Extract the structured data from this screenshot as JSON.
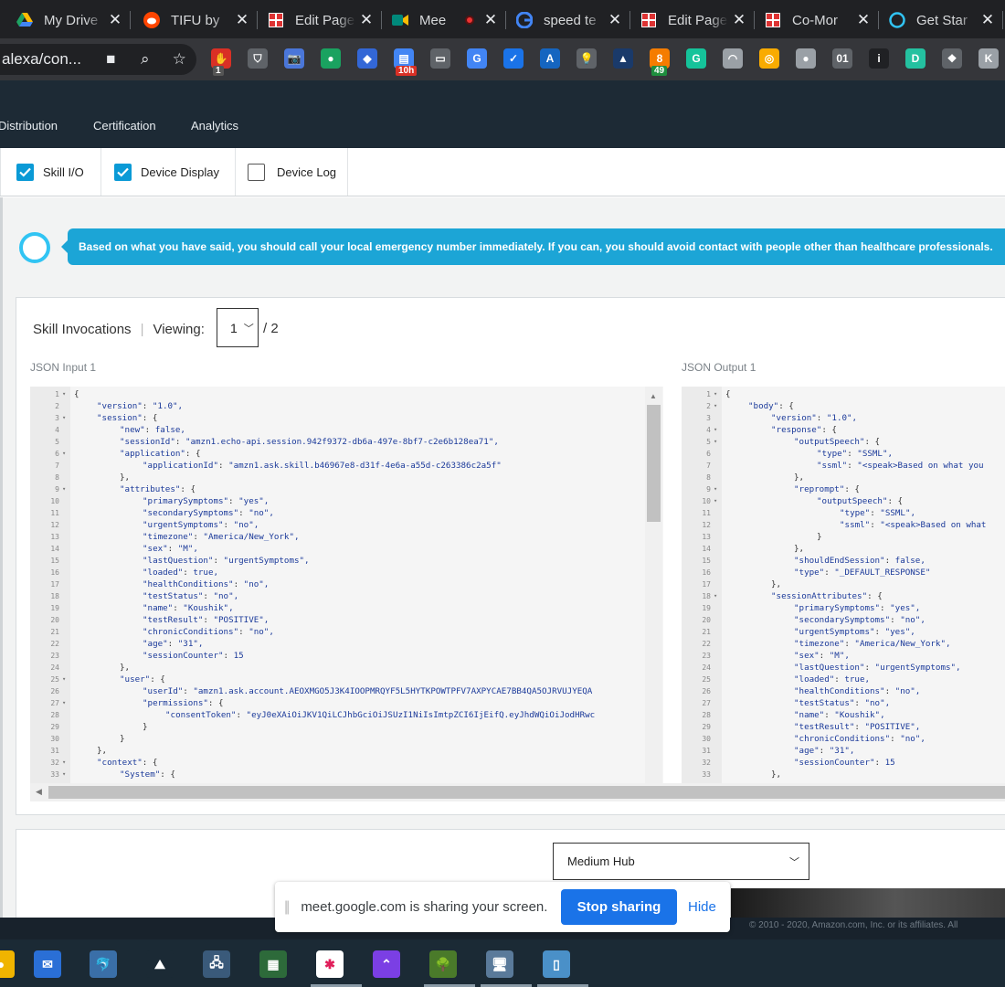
{
  "browser": {
    "tabs": [
      {
        "title": "My Drive",
        "icon": "google-drive-icon",
        "color": "#fbbc04"
      },
      {
        "title": "TIFU by",
        "icon": "reddit-icon",
        "color": "#ff4500"
      },
      {
        "title": "Edit Page",
        "icon": "page-icon",
        "color": "#d33"
      },
      {
        "title": "Mee",
        "icon": "google-meet-icon",
        "color": "#00897b"
      },
      {
        "title": "speed te",
        "icon": "google-icon",
        "color": "#4285f4"
      },
      {
        "title": "Edit Page",
        "icon": "page-icon",
        "color": "#d33"
      },
      {
        "title": "Co-Mor",
        "icon": "page-icon",
        "color": "#d33"
      },
      {
        "title": "Get Star",
        "icon": "alexa-icon",
        "color": "#31c4f3"
      }
    ],
    "url": "alexa/con...",
    "extensions": [
      {
        "name": "hand-stop-extension-icon",
        "color": "#d93025",
        "label": "✋",
        "badge": "1",
        "badge_color": "#555"
      },
      {
        "name": "pocket-extension-icon",
        "color": "#5f6368",
        "label": "⛉"
      },
      {
        "name": "camera-extension-icon",
        "color": "#4a76d9",
        "label": "📷"
      },
      {
        "name": "chat-bubble-extension-icon",
        "color": "#1aa260",
        "label": "●"
      },
      {
        "name": "arrow-extension-icon",
        "color": "#3367d6",
        "label": "◆"
      },
      {
        "name": "calendar-extension-icon",
        "color": "#4285f4",
        "label": "▤",
        "badge": "10h",
        "badge_color": "#d93025"
      },
      {
        "name": "cast-extension-icon",
        "color": "#5f6368",
        "label": "▭"
      },
      {
        "name": "translate-extension-icon",
        "color": "#4285f4",
        "label": "G"
      },
      {
        "name": "todo-extension-icon",
        "color": "#1a73e8",
        "label": "✓"
      },
      {
        "name": "font-extension-icon",
        "color": "#1565c0",
        "label": "A"
      },
      {
        "name": "bulb-extension-icon",
        "color": "#5f6368",
        "label": "💡"
      },
      {
        "name": "grid-extension-icon",
        "color": "#1a3a6a",
        "label": "▲"
      },
      {
        "name": "notes-extension-icon",
        "color": "#f57c00",
        "label": "8",
        "badge": "49",
        "badge_color": "#1e8e3e"
      },
      {
        "name": "grammarly-icon",
        "color": "#15c39a",
        "label": "G"
      },
      {
        "name": "arch-extension-icon",
        "color": "#9aa0a6",
        "label": "◠"
      },
      {
        "name": "compass-extension-icon",
        "color": "#f9ab00",
        "label": "◎"
      },
      {
        "name": "circle-extension-icon",
        "color": "#9aa0a6",
        "label": "●"
      },
      {
        "name": "binary-extension-icon",
        "color": "#5f6368",
        "label": "01"
      },
      {
        "name": "info-extension-icon",
        "color": "#202124",
        "label": "i"
      },
      {
        "name": "d-extension-icon",
        "color": "#24c1a0",
        "label": "D"
      },
      {
        "name": "dropbox-icon",
        "color": "#5f6368",
        "label": "❖"
      },
      {
        "name": "k-extension-icon",
        "color": "#9aa0a6",
        "label": "K"
      }
    ]
  },
  "console_nav": {
    "items": [
      "Distribution",
      "Certification",
      "Analytics"
    ]
  },
  "options": [
    {
      "label": "Skill I/O",
      "checked": true
    },
    {
      "label": "Device Display",
      "checked": true
    },
    {
      "label": "Device Log",
      "checked": false
    }
  ],
  "alexa_response": "Based on what you have said, you should call your local emergency number immediately. If you can, you should avoid contact with people other than healthcare professionals.",
  "invocations": {
    "title": "Skill Invocations",
    "viewing_label": "Viewing:",
    "selected": "1",
    "total": "/ 2"
  },
  "json_input": {
    "title": "JSON Input 1",
    "lines": [
      {
        "n": "1",
        "fold": true,
        "indent": 0,
        "text": "{"
      },
      {
        "n": "2",
        "indent": 1,
        "key": "\"version\"",
        "val": "\"1.0\","
      },
      {
        "n": "3",
        "fold": true,
        "indent": 1,
        "key": "\"session\"",
        "val": "{"
      },
      {
        "n": "4",
        "indent": 2,
        "key": "\"new\"",
        "val": "false,"
      },
      {
        "n": "5",
        "indent": 2,
        "key": "\"sessionId\"",
        "val": "\"amzn1.echo-api.session.942f9372-db6a-497e-8bf7-c2e6b128ea71\","
      },
      {
        "n": "6",
        "fold": true,
        "indent": 2,
        "key": "\"application\"",
        "val": "{"
      },
      {
        "n": "7",
        "indent": 3,
        "key": "\"applicationId\"",
        "val": "\"amzn1.ask.skill.b46967e8-d31f-4e6a-a55d-c263386c2a5f\""
      },
      {
        "n": "8",
        "indent": 2,
        "text": "},"
      },
      {
        "n": "9",
        "fold": true,
        "indent": 2,
        "key": "\"attributes\"",
        "val": "{"
      },
      {
        "n": "10",
        "indent": 3,
        "key": "\"primarySymptoms\"",
        "val": "\"yes\","
      },
      {
        "n": "11",
        "indent": 3,
        "key": "\"secondarySymptoms\"",
        "val": "\"no\","
      },
      {
        "n": "12",
        "indent": 3,
        "key": "\"urgentSymptoms\"",
        "val": "\"no\","
      },
      {
        "n": "13",
        "indent": 3,
        "key": "\"timezone\"",
        "val": "\"America/New_York\","
      },
      {
        "n": "14",
        "indent": 3,
        "key": "\"sex\"",
        "val": "\"M\","
      },
      {
        "n": "15",
        "indent": 3,
        "key": "\"lastQuestion\"",
        "val": "\"urgentSymptoms\","
      },
      {
        "n": "16",
        "indent": 3,
        "key": "\"loaded\"",
        "val": "true,"
      },
      {
        "n": "17",
        "indent": 3,
        "key": "\"healthConditions\"",
        "val": "\"no\","
      },
      {
        "n": "18",
        "indent": 3,
        "key": "\"testStatus\"",
        "val": "\"no\","
      },
      {
        "n": "19",
        "indent": 3,
        "key": "\"name\"",
        "val": "\"Koushik\","
      },
      {
        "n": "20",
        "indent": 3,
        "key": "\"testResult\"",
        "val": "\"POSITIVE\","
      },
      {
        "n": "21",
        "indent": 3,
        "key": "\"chronicConditions\"",
        "val": "\"no\","
      },
      {
        "n": "22",
        "indent": 3,
        "key": "\"age\"",
        "val": "\"31\","
      },
      {
        "n": "23",
        "indent": 3,
        "key": "\"sessionCounter\"",
        "val": "15"
      },
      {
        "n": "24",
        "indent": 2,
        "text": "},"
      },
      {
        "n": "25",
        "fold": true,
        "indent": 2,
        "key": "\"user\"",
        "val": "{"
      },
      {
        "n": "26",
        "indent": 3,
        "key": "\"userId\"",
        "val": "\"amzn1.ask.account.AEOXMGO5J3K4IOOPMRQYF5L5HYTKPOWTPFV7AXPYCAE7BB4QA5OJRVUJYEQA"
      },
      {
        "n": "27",
        "fold": true,
        "indent": 3,
        "key": "\"permissions\"",
        "val": "{"
      },
      {
        "n": "28",
        "indent": 4,
        "key": "\"consentToken\"",
        "val": "\"eyJ0eXAiOiJKV1QiLCJhbGciOiJSUzI1NiIsImtpZCI6IjEifQ.eyJhdWQiOiJodHRwc"
      },
      {
        "n": "29",
        "indent": 3,
        "text": "}"
      },
      {
        "n": "30",
        "indent": 2,
        "text": "}"
      },
      {
        "n": "31",
        "indent": 1,
        "text": "},"
      },
      {
        "n": "32",
        "fold": true,
        "indent": 1,
        "key": "\"context\"",
        "val": "{"
      },
      {
        "n": "33",
        "fold": true,
        "indent": 2,
        "key": "\"System\"",
        "val": "{"
      }
    ]
  },
  "json_output": {
    "title": "JSON Output 1",
    "lines": [
      {
        "n": "1",
        "fold": true,
        "indent": 0,
        "text": "{"
      },
      {
        "n": "2",
        "fold": true,
        "indent": 1,
        "key": "\"body\"",
        "val": "{"
      },
      {
        "n": "3",
        "indent": 2,
        "key": "\"version\"",
        "val": "\"1.0\","
      },
      {
        "n": "4",
        "fold": true,
        "indent": 2,
        "key": "\"response\"",
        "val": "{"
      },
      {
        "n": "5",
        "fold": true,
        "indent": 3,
        "key": "\"outputSpeech\"",
        "val": "{"
      },
      {
        "n": "6",
        "indent": 4,
        "key": "\"type\"",
        "val": "\"SSML\","
      },
      {
        "n": "7",
        "indent": 4,
        "key": "\"ssml\"",
        "val": "\"<speak>Based on what you"
      },
      {
        "n": "8",
        "indent": 3,
        "text": "},"
      },
      {
        "n": "9",
        "fold": true,
        "indent": 3,
        "key": "\"reprompt\"",
        "val": "{"
      },
      {
        "n": "10",
        "fold": true,
        "indent": 4,
        "key": "\"outputSpeech\"",
        "val": "{"
      },
      {
        "n": "11",
        "indent": 5,
        "key": "\"type\"",
        "val": "\"SSML\","
      },
      {
        "n": "12",
        "indent": 5,
        "key": "\"ssml\"",
        "val": "\"<speak>Based on what"
      },
      {
        "n": "13",
        "indent": 4,
        "text": "}"
      },
      {
        "n": "14",
        "indent": 3,
        "text": "},"
      },
      {
        "n": "15",
        "indent": 3,
        "key": "\"shouldEndSession\"",
        "val": "false,"
      },
      {
        "n": "16",
        "indent": 3,
        "key": "\"type\"",
        "val": "\"_DEFAULT_RESPONSE\""
      },
      {
        "n": "17",
        "indent": 2,
        "text": "},"
      },
      {
        "n": "18",
        "fold": true,
        "indent": 2,
        "key": "\"sessionAttributes\"",
        "val": "{"
      },
      {
        "n": "19",
        "indent": 3,
        "key": "\"primarySymptoms\"",
        "val": "\"yes\","
      },
      {
        "n": "20",
        "indent": 3,
        "key": "\"secondarySymptoms\"",
        "val": "\"no\","
      },
      {
        "n": "21",
        "indent": 3,
        "key": "\"urgentSymptoms\"",
        "val": "\"yes\","
      },
      {
        "n": "22",
        "indent": 3,
        "key": "\"timezone\"",
        "val": "\"America/New_York\","
      },
      {
        "n": "23",
        "indent": 3,
        "key": "\"sex\"",
        "val": "\"M\","
      },
      {
        "n": "24",
        "indent": 3,
        "key": "\"lastQuestion\"",
        "val": "\"urgentSymptoms\","
      },
      {
        "n": "25",
        "indent": 3,
        "key": "\"loaded\"",
        "val": "true,"
      },
      {
        "n": "26",
        "indent": 3,
        "key": "\"healthConditions\"",
        "val": "\"no\","
      },
      {
        "n": "27",
        "indent": 3,
        "key": "\"testStatus\"",
        "val": "\"no\","
      },
      {
        "n": "28",
        "indent": 3,
        "key": "\"name\"",
        "val": "\"Koushik\","
      },
      {
        "n": "29",
        "indent": 3,
        "key": "\"testResult\"",
        "val": "\"POSITIVE\","
      },
      {
        "n": "30",
        "indent": 3,
        "key": "\"chronicConditions\"",
        "val": "\"no\","
      },
      {
        "n": "31",
        "indent": 3,
        "key": "\"age\"",
        "val": "\"31\","
      },
      {
        "n": "32",
        "indent": 3,
        "key": "\"sessionCounter\"",
        "val": "15"
      },
      {
        "n": "33",
        "indent": 2,
        "text": "},"
      }
    ]
  },
  "device": {
    "selected": "Medium Hub"
  },
  "screen_share": {
    "message": "meet.google.com is sharing your screen.",
    "stop_label": "Stop sharing",
    "hide_label": "Hide"
  },
  "footer": {
    "copyright": "© 2010 - 2020, Amazon.com, Inc. or its affiliates. All"
  },
  "taskbar": [
    {
      "name": "windows-search-icon",
      "color": "#f0b400",
      "label": "●"
    },
    {
      "name": "thunderbird-icon",
      "color": "#2a6fd6",
      "label": "✉"
    },
    {
      "name": "mysql-workbench-icon",
      "color": "#3a6fa8",
      "label": "🐬"
    },
    {
      "name": "mountain-app-icon",
      "color": "#1b2a35",
      "label": "⛰"
    },
    {
      "name": "network-icon",
      "color": "#3a5a7a",
      "label": "🖧"
    },
    {
      "name": "terminal-icon",
      "color": "#2d6a3a",
      "label": "▦"
    },
    {
      "name": "slack-icon",
      "color": "#ffffff",
      "label": "✱"
    },
    {
      "name": "clickup-icon",
      "color": "#7b3fe4",
      "label": "⌃"
    },
    {
      "name": "tree-app-icon",
      "color": "#4a7a2a",
      "label": "🌳"
    },
    {
      "name": "remote-desktop-icon",
      "color": "#5a7a9a",
      "label": "🖥"
    },
    {
      "name": "phone-link-icon",
      "color": "#4a90c8",
      "label": "▯"
    }
  ]
}
